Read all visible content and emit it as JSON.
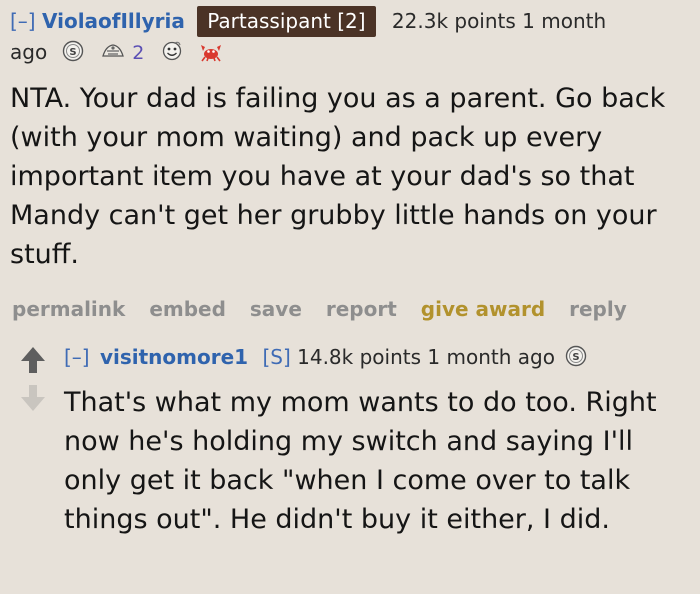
{
  "parent_comment": {
    "toggle": "[–]",
    "username": "ViolaofIllyria",
    "flair": "Partassipant [2]",
    "points": "22.3k points",
    "time_part1": "1 month",
    "time_part2": "ago",
    "award_count": "2",
    "body": "NTA. Your dad is failing you as a parent. Go back (with your mom waiting) and pack up every important item you have at your dad's so that Mandy can't get her grubby little hands on your stuff.",
    "buttons": {
      "permalink": "permalink",
      "embed": "embed",
      "save": "save",
      "report": "report",
      "give_award": "give award",
      "reply": "reply"
    }
  },
  "child_comment": {
    "toggle": "[–]",
    "username": "visitnomore1",
    "submitter_tag": "[S]",
    "points": "14.8k points",
    "time": "1 month ago",
    "body": "That's what my mom wants to do too. Right now he's holding my switch and saying I'll only get it back \"when I come over to talk things out\". He didn't buy it either, I did."
  },
  "colors": {
    "background": "#e7e1d9",
    "username": "#2f63ad",
    "flair_bg": "#4b3326",
    "button_gray": "#8e8e8e",
    "give_award_gold": "#b2922d"
  },
  "icons": [
    "silver-award-icon",
    "helpful-award-icon",
    "wholesome-award-icon",
    "crab-award-icon",
    "upvote-arrow-icon",
    "downvote-arrow-icon"
  ]
}
